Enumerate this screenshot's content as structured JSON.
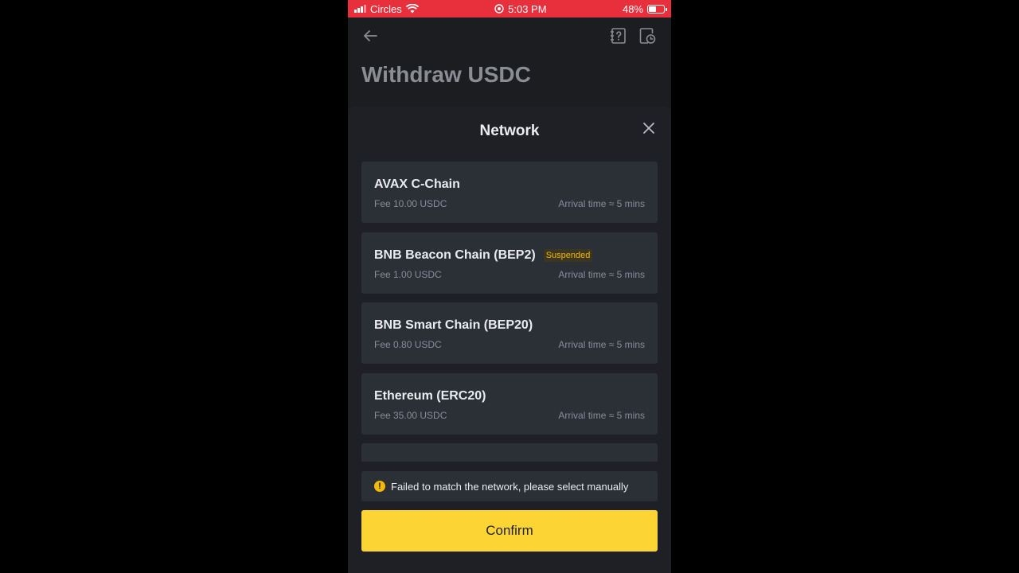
{
  "status_bar": {
    "carrier": "Circles",
    "time": "5:03 PM",
    "battery": "48%",
    "battery_level": 0.48,
    "icons": [
      "signal-icon",
      "wifi-icon",
      "location-icon",
      "battery-icon"
    ]
  },
  "header": {
    "title": "Withdraw USDC",
    "icons": [
      "back-arrow-icon",
      "guide-icon",
      "history-icon"
    ]
  },
  "sheet": {
    "title": "Network",
    "networks": [
      {
        "name": "AVAX C-Chain",
        "badge": "",
        "fee": "Fee 10.00 USDC",
        "arrival": "Arrival time ≈ 5 mins"
      },
      {
        "name": "BNB Beacon Chain (BEP2)",
        "badge": "Suspended",
        "fee": "Fee 1.00 USDC",
        "arrival": "Arrival time ≈ 5 mins"
      },
      {
        "name": "BNB Smart Chain (BEP20)",
        "badge": "",
        "fee": "Fee 0.80 USDC",
        "arrival": "Arrival time ≈ 5 mins"
      },
      {
        "name": "Ethereum (ERC20)",
        "badge": "",
        "fee": "Fee 35.00 USDC",
        "arrival": "Arrival time ≈ 5 mins"
      }
    ],
    "warning": "Failed to match the network, please select manually",
    "confirm_label": "Confirm"
  },
  "colors": {
    "accent": "#fcd535",
    "status_bar": "#e8303d",
    "badge_text": "#f0b90b",
    "background": "#1e2026",
    "card": "#2b2f36"
  }
}
